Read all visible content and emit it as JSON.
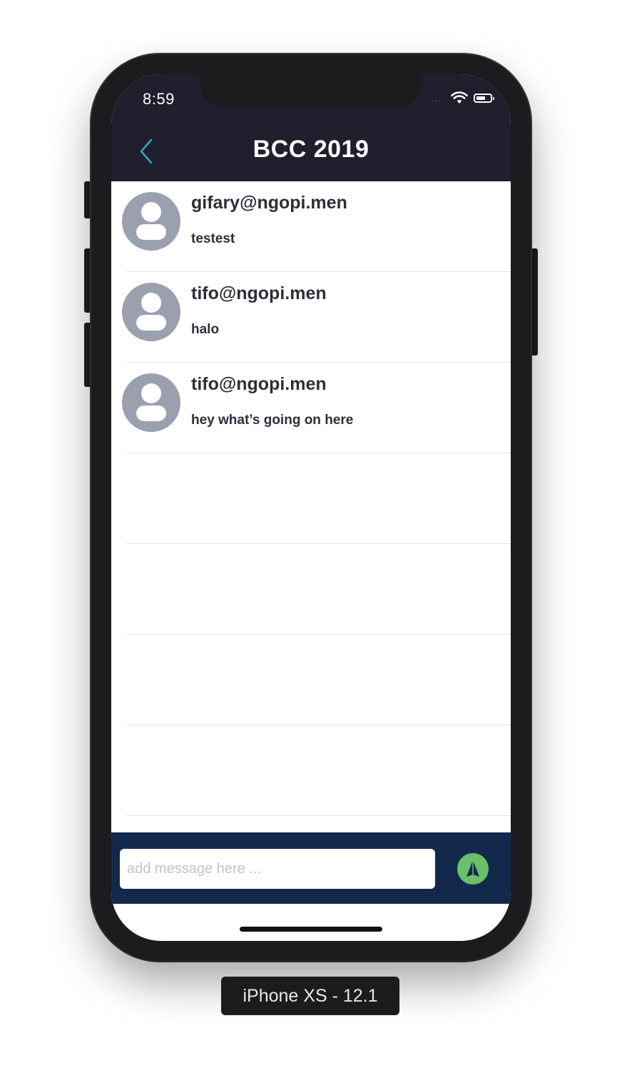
{
  "status_bar": {
    "time": "8:59",
    "signal_dots": "....",
    "icons": [
      "wifi-icon",
      "battery-icon"
    ]
  },
  "navbar": {
    "title": "BCC 2019",
    "back_icon": "chevron-left-icon"
  },
  "messages": [
    {
      "sender": "gifary@ngopi.men",
      "text": "testest"
    },
    {
      "sender": "tifo@ngopi.men",
      "text": "halo"
    },
    {
      "sender": "tifo@ngopi.men",
      "text": "hey what’s going on here"
    }
  ],
  "composer": {
    "placeholder": "add message here ...",
    "value": "",
    "send_icon": "send-arrow-icon"
  },
  "device_label": "iPhone XS - 12.1",
  "colors": {
    "navbar_bg": "#1f1f2e",
    "accent_back": "#2fa4c8",
    "composer_bg": "#13294b",
    "send_button": "#6abf69",
    "avatar_bg": "#9aa0ad"
  }
}
